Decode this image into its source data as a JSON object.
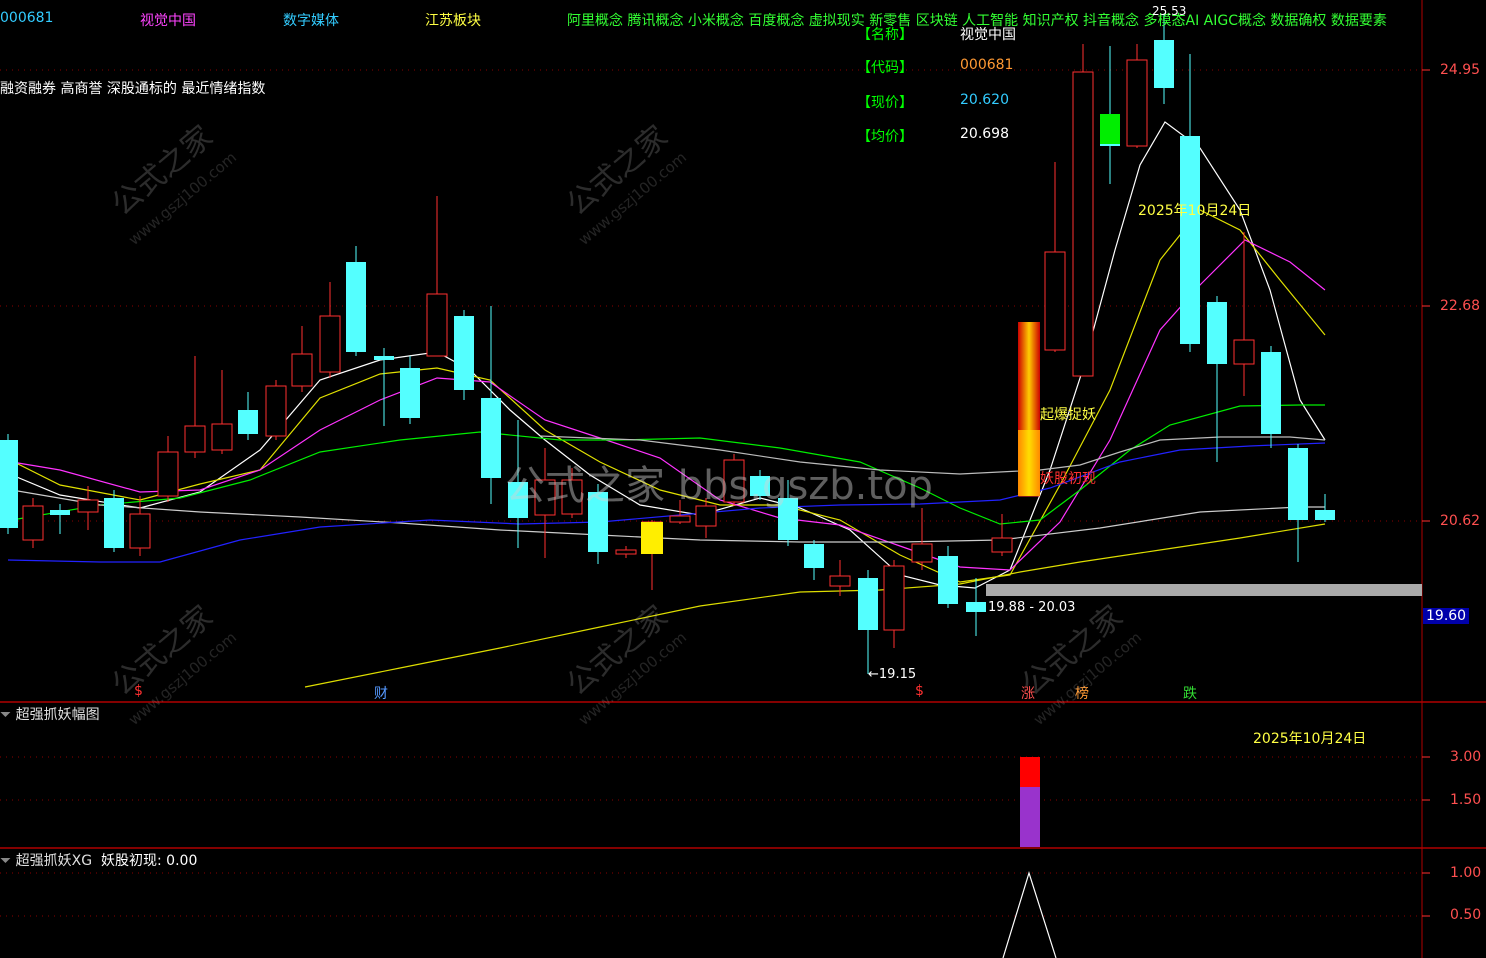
{
  "header": {
    "code": "000681",
    "name": "视觉中国",
    "industry": "数字媒体",
    "region": "江苏板块",
    "concepts": "阿里概念 腾讯概念 小米概念 百度概念 虚拟现实 新零售 区块链 人工智能 知识产权 抖音概念 多模态AI AIGC概念 数据确权 数据要素"
  },
  "subtitle": "融资融券 高商誉 深股通标的 最近情绪指数",
  "info_panel": {
    "name_label": "【名称】",
    "name_value": "视觉中国",
    "code_label": "【代码】",
    "code_value": "000681",
    "price_label": "【现价】",
    "price_value": "20.620",
    "avg_label": "【均价】",
    "avg_value": "20.698"
  },
  "annotations": {
    "date": "2025年10月24日",
    "signal_1": "起爆捉妖",
    "signal_2": "妖股初现",
    "range": "19.88 - 20.03",
    "low": "19.15",
    "peak": "25.53"
  },
  "markers": [
    {
      "text": "$",
      "color": "#ff3030"
    },
    {
      "text": "财",
      "color": "#5599ff"
    },
    {
      "text": "$",
      "color": "#ff3030"
    },
    {
      "text": "涨",
      "color": "#ff5050"
    },
    {
      "text": "榜",
      "color": "#ff9933"
    },
    {
      "text": "跌",
      "color": "#33dd33"
    }
  ],
  "price_axis": {
    "labels": [
      "24.95",
      "22.68",
      "20.62"
    ],
    "current": "19.60"
  },
  "panel_amplitude": {
    "title": "超强抓妖幅图",
    "date": "2025年10月24日",
    "axis": [
      "3.00",
      "1.50"
    ]
  },
  "panel_xg": {
    "title": "超强抓妖XG",
    "indicator": "妖股初现: 0.00",
    "axis": [
      "1.00",
      "0.50"
    ]
  },
  "watermarks": {
    "main": "公式之家 bbs.gszb.top",
    "brand": "公式之家",
    "url": "www.gszj100.com"
  },
  "colors": {
    "up": "#ff3030",
    "down": "#54ffff",
    "ma_white": "#ffffff",
    "ma_yellow": "#e0e000",
    "ma_magenta": "#ff33ff",
    "ma_green": "#00ee00",
    "ma_blue": "#2222ff",
    "ma_gray": "#cccccc"
  }
}
